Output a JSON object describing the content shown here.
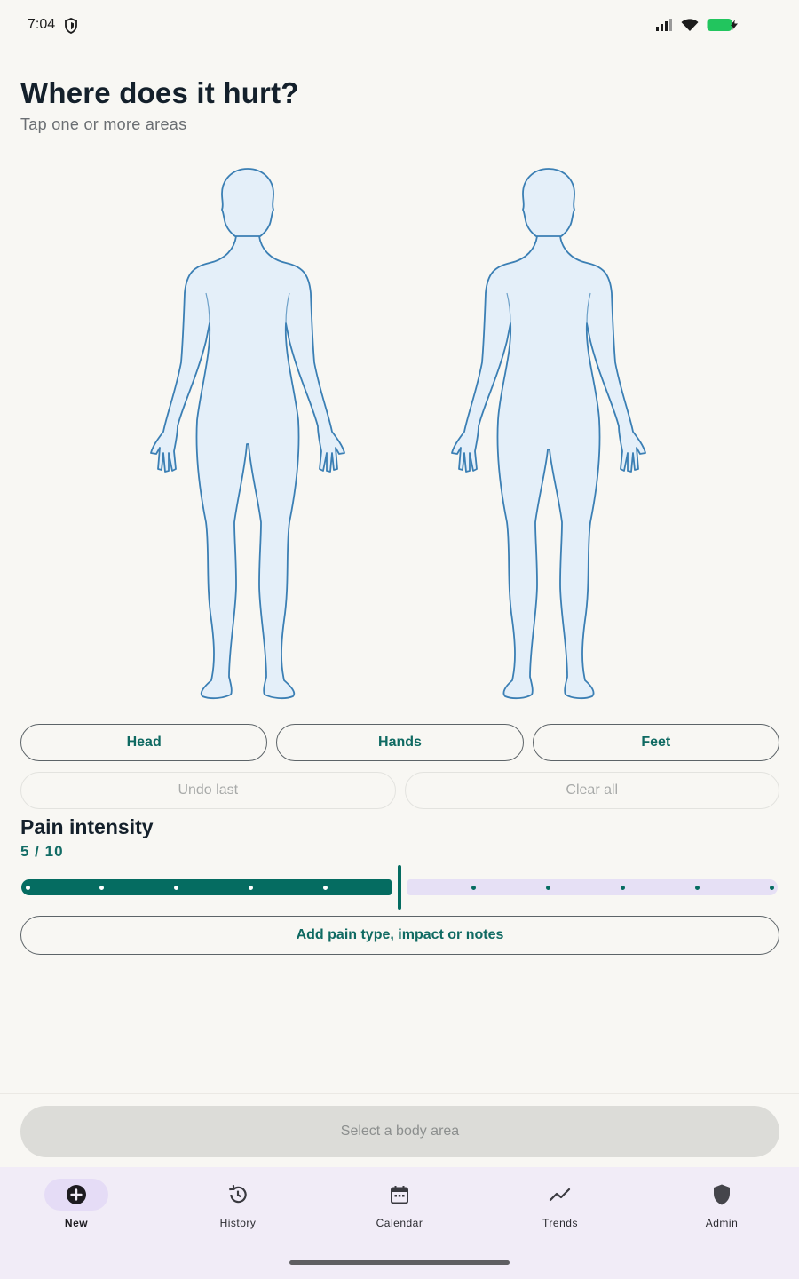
{
  "status_bar": {
    "time": "7:04",
    "icons": [
      "shield-icon",
      "signal-icon",
      "wifi-icon",
      "battery-charging-icon"
    ],
    "battery_color": "#22c55e"
  },
  "header": {
    "title": "Where does it hurt?",
    "subtitle": "Tap one or more areas"
  },
  "body_map": {
    "views": [
      "front",
      "back"
    ],
    "fill_color": "#e4eff9",
    "stroke_color": "#3b7fb4"
  },
  "quick_select": {
    "chips": [
      {
        "label": "Head"
      },
      {
        "label": "Hands"
      },
      {
        "label": "Feet"
      }
    ]
  },
  "actions": {
    "undo_label": "Undo last",
    "clear_label": "Clear all"
  },
  "pain": {
    "title": "Pain intensity",
    "value_label": "5 / 10",
    "value": 5,
    "max": 10,
    "accent_color": "#056c61"
  },
  "notes_button": {
    "label": "Add pain type, impact or notes"
  },
  "primary_button": {
    "label": "Select a body area",
    "enabled": false
  },
  "nav": {
    "items": [
      {
        "label": "New",
        "icon": "add-circle-icon",
        "active": true
      },
      {
        "label": "History",
        "icon": "history-icon",
        "active": false
      },
      {
        "label": "Calendar",
        "icon": "calendar-icon",
        "active": false
      },
      {
        "label": "Trends",
        "icon": "trends-icon",
        "active": false
      },
      {
        "label": "Admin",
        "icon": "shield-icon",
        "active": false
      }
    ]
  }
}
